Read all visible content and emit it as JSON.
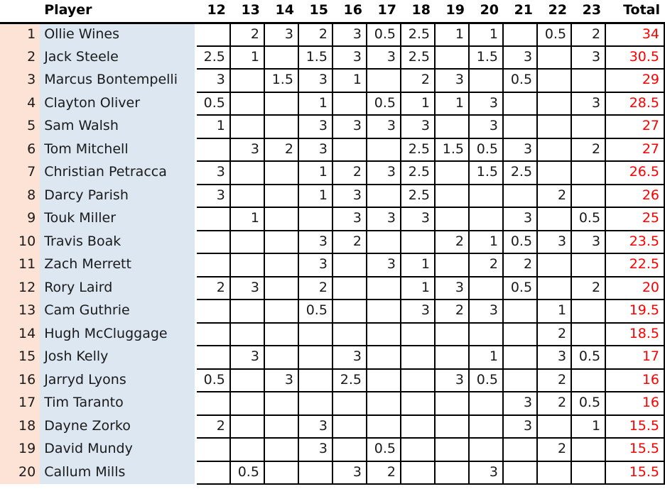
{
  "table": {
    "headers": {
      "rank": "",
      "player": "Player",
      "rounds": [
        "12",
        "13",
        "14",
        "15",
        "16",
        "17",
        "18",
        "19",
        "20",
        "21",
        "22",
        "23"
      ],
      "total": "Total"
    },
    "colors": {
      "rank_bg": "#fce3d5",
      "name_bg": "#dce7f2",
      "cell_bg": "#ffffff",
      "total_text": "#ff0000",
      "text": "#1a1a1a",
      "gridline": "#000000"
    },
    "rows": [
      {
        "rank": "1",
        "player": "Ollie Wines",
        "values": [
          "",
          "2",
          "3",
          "2",
          "3",
          "0.5",
          "2.5",
          "1",
          "1",
          "",
          "0.5",
          "2"
        ],
        "total": "34"
      },
      {
        "rank": "2",
        "player": "Jack Steele",
        "values": [
          "2.5",
          "1",
          "",
          "1.5",
          "3",
          "3",
          "2.5",
          "",
          "1.5",
          "3",
          "",
          "3"
        ],
        "total": "30.5"
      },
      {
        "rank": "3",
        "player": "Marcus Bontempelli",
        "values": [
          "3",
          "",
          "1.5",
          "3",
          "1",
          "",
          "2",
          "3",
          "",
          "0.5",
          "",
          ""
        ],
        "total": "29"
      },
      {
        "rank": "4",
        "player": "Clayton Oliver",
        "values": [
          "0.5",
          "",
          "",
          "1",
          "",
          "0.5",
          "1",
          "1",
          "3",
          "",
          "",
          "3"
        ],
        "total": "28.5"
      },
      {
        "rank": "5",
        "player": "Sam Walsh",
        "values": [
          "1",
          "",
          "",
          "3",
          "3",
          "3",
          "3",
          "",
          "3",
          "",
          "",
          ""
        ],
        "total": "27"
      },
      {
        "rank": "6",
        "player": "Tom Mitchell",
        "values": [
          "",
          "3",
          "2",
          "3",
          "",
          "",
          "2.5",
          "1.5",
          "0.5",
          "3",
          "",
          "2"
        ],
        "total": "27"
      },
      {
        "rank": "7",
        "player": "Christian Petracca",
        "values": [
          "3",
          "",
          "",
          "1",
          "2",
          "3",
          "2.5",
          "",
          "1.5",
          "2.5",
          "",
          ""
        ],
        "total": "26.5"
      },
      {
        "rank": "8",
        "player": "Darcy Parish",
        "values": [
          "3",
          "",
          "",
          "1",
          "3",
          "",
          "2.5",
          "",
          "",
          "",
          "2",
          ""
        ],
        "total": "26"
      },
      {
        "rank": "9",
        "player": "Touk Miller",
        "values": [
          "",
          "1",
          "",
          "",
          "3",
          "3",
          "3",
          "",
          "",
          "3",
          "",
          "0.5"
        ],
        "total": "25"
      },
      {
        "rank": "10",
        "player": "Travis Boak",
        "values": [
          "",
          "",
          "",
          "3",
          "2",
          "",
          "",
          "2",
          "1",
          "0.5",
          "3",
          "3"
        ],
        "total": "23.5"
      },
      {
        "rank": "11",
        "player": "Zach Merrett",
        "values": [
          "",
          "",
          "",
          "3",
          "",
          "3",
          "1",
          "",
          "2",
          "2",
          "",
          ""
        ],
        "total": "22.5"
      },
      {
        "rank": "12",
        "player": "Rory Laird",
        "values": [
          "2",
          "3",
          "",
          "2",
          "",
          "",
          "1",
          "3",
          "",
          "0.5",
          "",
          "2"
        ],
        "total": "20"
      },
      {
        "rank": "13",
        "player": "Cam Guthrie",
        "values": [
          "",
          "",
          "",
          "0.5",
          "",
          "",
          "3",
          "2",
          "3",
          "",
          "1",
          ""
        ],
        "total": "19.5"
      },
      {
        "rank": "14",
        "player": "Hugh McCluggage",
        "values": [
          "",
          "",
          "",
          "",
          "",
          "",
          "",
          "",
          "",
          "",
          "2",
          ""
        ],
        "total": "18.5"
      },
      {
        "rank": "15",
        "player": "Josh Kelly",
        "values": [
          "",
          "3",
          "",
          "",
          "3",
          "",
          "",
          "",
          "1",
          "",
          "3",
          "0.5"
        ],
        "total": "17"
      },
      {
        "rank": "16",
        "player": "Jarryd Lyons",
        "values": [
          "0.5",
          "",
          "3",
          "",
          "2.5",
          "",
          "",
          "3",
          "0.5",
          "",
          "2",
          ""
        ],
        "total": "16"
      },
      {
        "rank": "17",
        "player": "Tim Taranto",
        "values": [
          "",
          "",
          "",
          "",
          "",
          "",
          "",
          "",
          "",
          "3",
          "2",
          "0.5"
        ],
        "total": "16"
      },
      {
        "rank": "18",
        "player": "Dayne Zorko",
        "values": [
          "2",
          "",
          "",
          "3",
          "",
          "",
          "",
          "",
          "",
          "3",
          "",
          "1"
        ],
        "total": "15.5"
      },
      {
        "rank": "19",
        "player": "David Mundy",
        "values": [
          "",
          "",
          "",
          "3",
          "",
          "0.5",
          "",
          "",
          "",
          "",
          "2",
          ""
        ],
        "total": "15.5"
      },
      {
        "rank": "20",
        "player": "Callum Mills",
        "values": [
          "",
          "0.5",
          "",
          "",
          "3",
          "2",
          "",
          "",
          "3",
          "",
          "",
          ""
        ],
        "total": "15.5"
      }
    ]
  }
}
